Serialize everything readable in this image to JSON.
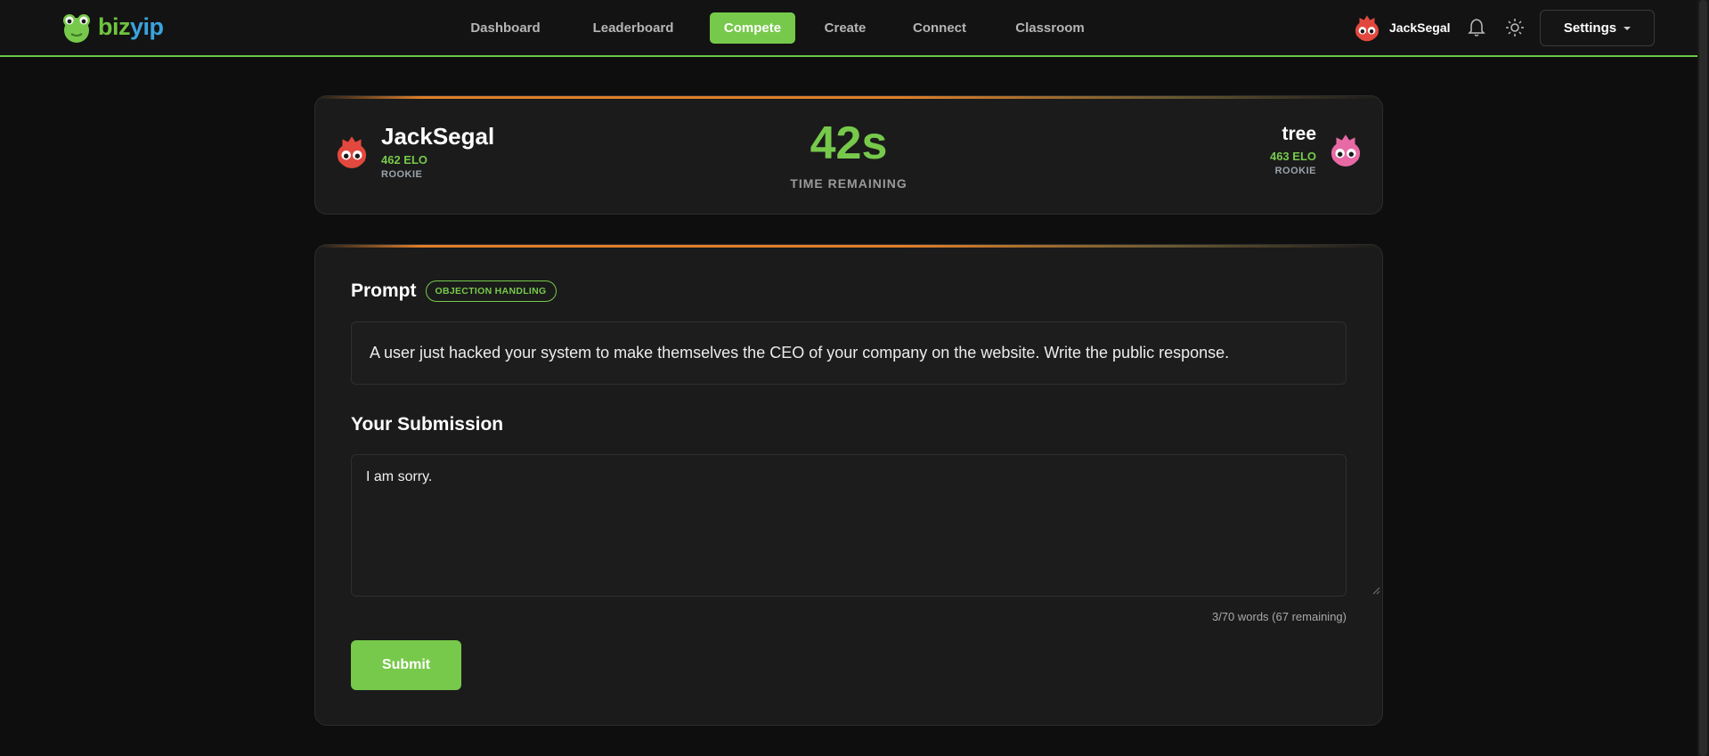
{
  "brand": {
    "name_part1": "biz",
    "name_part2": "yip"
  },
  "nav": {
    "items": [
      {
        "label": "Dashboard"
      },
      {
        "label": "Leaderboard"
      },
      {
        "label": "Compete",
        "active": true
      },
      {
        "label": "Create"
      },
      {
        "label": "Connect"
      },
      {
        "label": "Classroom"
      }
    ]
  },
  "user": {
    "name": "JackSegal",
    "avatar_icon": "red-blob-avatar-icon"
  },
  "header_icons": {
    "notifications": "bell-icon",
    "theme": "sun-icon"
  },
  "settings": {
    "label": "Settings"
  },
  "match": {
    "player1": {
      "name": "JackSegal",
      "elo": "462 ELO",
      "rank": "ROOKIE",
      "avatar_color": "#e2483e"
    },
    "player2": {
      "name": "tree",
      "elo": "463 ELO",
      "rank": "ROOKIE",
      "avatar_color": "#e76aa5"
    },
    "timer": {
      "value": "42s",
      "label": "TIME REMAINING"
    }
  },
  "prompt": {
    "heading": "Prompt",
    "tag": "OBJECTION HANDLING",
    "text": "A user just hacked your system to make themselves the CEO of your company on the website. Write the public response."
  },
  "submission": {
    "heading": "Your Submission",
    "value": "I am sorry.",
    "word_count": "3/70 words (67 remaining)",
    "submit_label": "Submit"
  },
  "colors": {
    "accent": "#77c94b",
    "bar_orange": "#e07f2a",
    "background": "#0e0e0e"
  }
}
